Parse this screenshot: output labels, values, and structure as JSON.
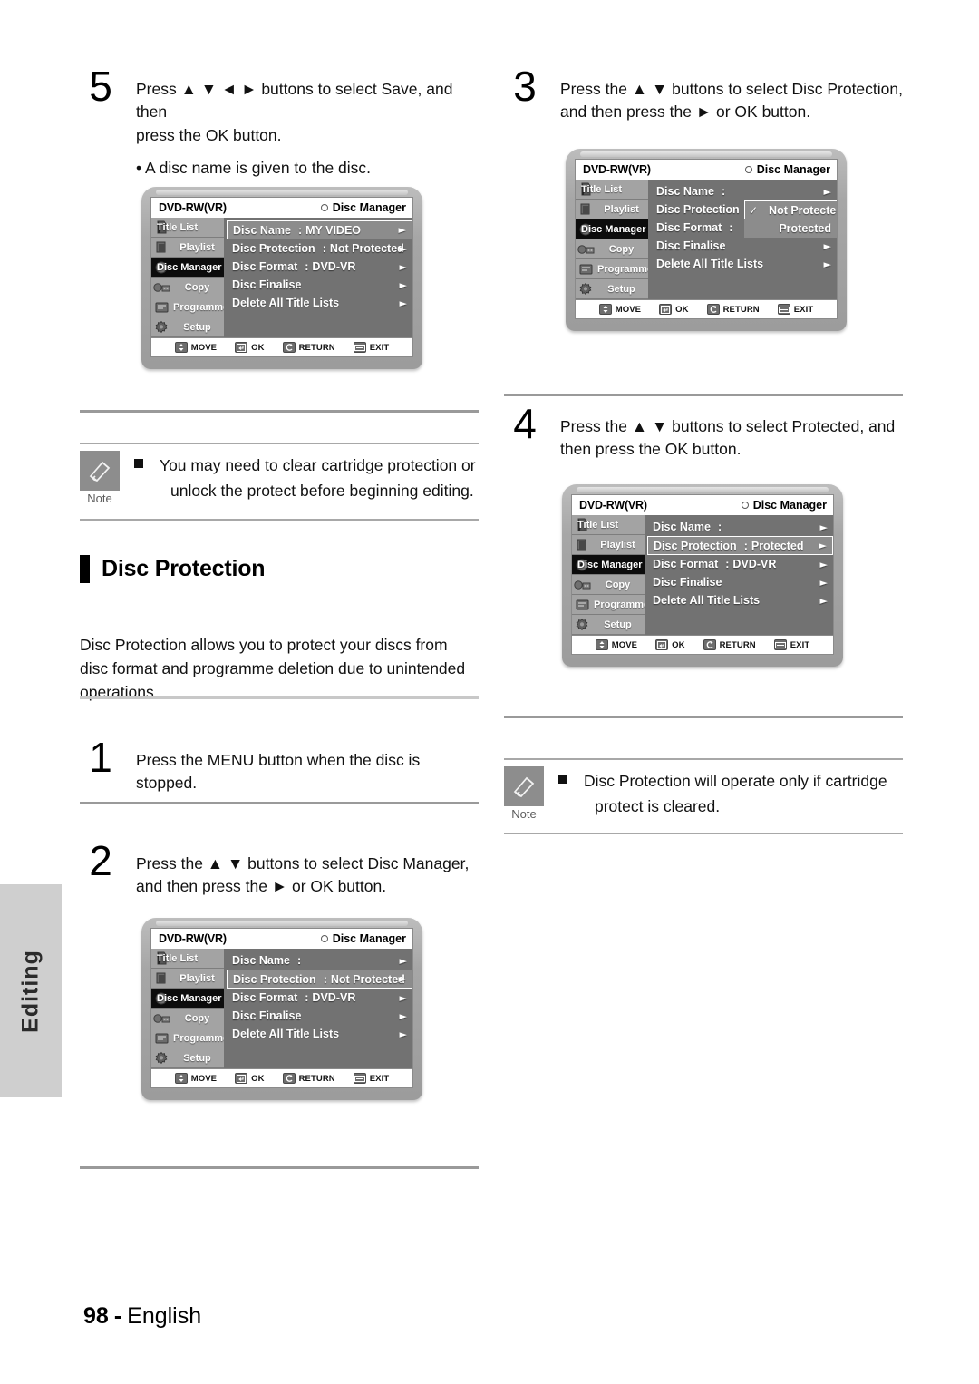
{
  "sidetab": {
    "label": "Editing"
  },
  "footer": {
    "page": "98",
    "dash": "-",
    "language": "English"
  },
  "glyphs": {
    "up": "▲",
    "down": "▼",
    "left": "◄",
    "right": "►",
    "arrow": "►",
    "check": "✓",
    "dot": "○"
  },
  "steps": {
    "s5": {
      "num": "5",
      "line1": "Press ▲ ▼ ◄ ► buttons to select Save, and then",
      "line2": "press the OK button.",
      "bullet": "• A disc name is given to the disc."
    },
    "s1": {
      "num": "1",
      "line1": "Press the MENU button when the disc is",
      "line2": "stopped."
    },
    "s2": {
      "num": "2",
      "line1": "Press the ▲ ▼ buttons to select Disc Manager,",
      "line2": "and then press the ► or OK  button."
    },
    "s3": {
      "num": "3",
      "line1": "Press the ▲ ▼ buttons to select Disc Protection,",
      "line2": "and then press the ► or OK  button."
    },
    "s4": {
      "num": "4",
      "line1": "Press the ▲ ▼ buttons to select Protected, and",
      "line2": "then press the OK button."
    }
  },
  "notes": {
    "left": {
      "icon_label": "Note",
      "line1": "You may need to clear cartridge protection or",
      "line2": "unlock the protect before beginning editing."
    },
    "right": {
      "icon_label": "Note",
      "line1": "Disc Protection will operate only if cartridge",
      "line2": "protect is cleared."
    }
  },
  "section": {
    "title": "Disc Protection",
    "body_line1": "Disc Protection allows you to protect your discs from",
    "body_line2": "disc format and programme deletion due to unintended",
    "body_line3": "operations."
  },
  "osd": {
    "disc_label": "DVD-RW(VR)",
    "mode_label": "Disc Manager",
    "sidebar": [
      {
        "label": "Title List",
        "icon": "title-list-icon",
        "selected": false
      },
      {
        "label": "Playlist",
        "icon": "playlist-icon",
        "selected": false
      },
      {
        "label": "Disc Manager",
        "icon": "disc-manager-icon",
        "selected": true
      },
      {
        "label": "Copy",
        "icon": "copy-icon",
        "selected": false
      },
      {
        "label": "Programme",
        "icon": "programme-icon",
        "selected": false
      },
      {
        "label": "Setup",
        "icon": "setup-icon",
        "selected": false
      }
    ],
    "bottombar": [
      {
        "label": "MOVE",
        "icon": "dpad-updown-icon"
      },
      {
        "label": "OK",
        "icon": "enter-key-icon"
      },
      {
        "label": "RETURN",
        "icon": "return-arrow-icon"
      },
      {
        "label": "EXIT",
        "icon": "exit-key-icon"
      }
    ]
  },
  "screens": {
    "screen5": {
      "rows": [
        {
          "label": "Disc Name",
          "colon": ":",
          "value": "MY VIDEO",
          "arrow": "►",
          "highlight": true
        },
        {
          "label": "Disc Protection",
          "colon": ":",
          "value": "Not Protected",
          "arrow": "►",
          "highlight": false
        },
        {
          "label": "Disc Format",
          "colon": ":",
          "value": "DVD-VR",
          "arrow": "►",
          "highlight": false
        },
        {
          "label": "Disc Finalise",
          "colon": "",
          "value": "",
          "arrow": "►",
          "highlight": false
        },
        {
          "label": "Delete All Title Lists",
          "colon": "",
          "value": "",
          "arrow": "►",
          "highlight": false
        }
      ]
    },
    "screen2": {
      "rows": [
        {
          "label": "Disc Name",
          "colon": ":",
          "value": "",
          "arrow": "►",
          "highlight": false
        },
        {
          "label": "Disc Protection",
          "colon": ":",
          "value": "Not Protected",
          "arrow": "►",
          "highlight": true
        },
        {
          "label": "Disc Format",
          "colon": ":",
          "value": "DVD-VR",
          "arrow": "►",
          "highlight": false
        },
        {
          "label": "Disc Finalise",
          "colon": "",
          "value": "",
          "arrow": "►",
          "highlight": false
        },
        {
          "label": "Delete All Title Lists",
          "colon": "",
          "value": "",
          "arrow": "►",
          "highlight": false
        }
      ]
    },
    "screen3": {
      "rows": [
        {
          "label": "Disc Name",
          "colon": ":",
          "value": "",
          "arrow": "►",
          "highlight": false
        },
        {
          "label": "Disc Protection",
          "colon": ":",
          "value": "",
          "arrow": "►",
          "highlight": false
        },
        {
          "label": "Disc Format",
          "colon": ":",
          "value": "",
          "arrow": "►",
          "highlight": false
        },
        {
          "label": "Disc Finalise",
          "colon": "",
          "value": "",
          "arrow": "►",
          "highlight": false
        },
        {
          "label": "Delete All Title Lists",
          "colon": "",
          "value": "",
          "arrow": "►",
          "highlight": false
        }
      ],
      "dropdown": {
        "options": [
          {
            "label": "Not Protected",
            "checked": true,
            "selected": true
          },
          {
            "label": "Protected",
            "checked": false,
            "selected": false
          }
        ]
      }
    },
    "screen4": {
      "rows": [
        {
          "label": "Disc Name",
          "colon": ":",
          "value": "",
          "arrow": "►",
          "highlight": false
        },
        {
          "label": "Disc Protection",
          "colon": ":",
          "value": "Protected",
          "arrow": "►",
          "highlight": true
        },
        {
          "label": "Disc Format",
          "colon": ":",
          "value": "DVD-VR",
          "arrow": "►",
          "highlight": false
        },
        {
          "label": "Disc Finalise",
          "colon": "",
          "value": "",
          "arrow": "►",
          "highlight": false
        },
        {
          "label": "Delete All Title Lists",
          "colon": "",
          "value": "",
          "arrow": "►",
          "highlight": false
        }
      ]
    }
  }
}
